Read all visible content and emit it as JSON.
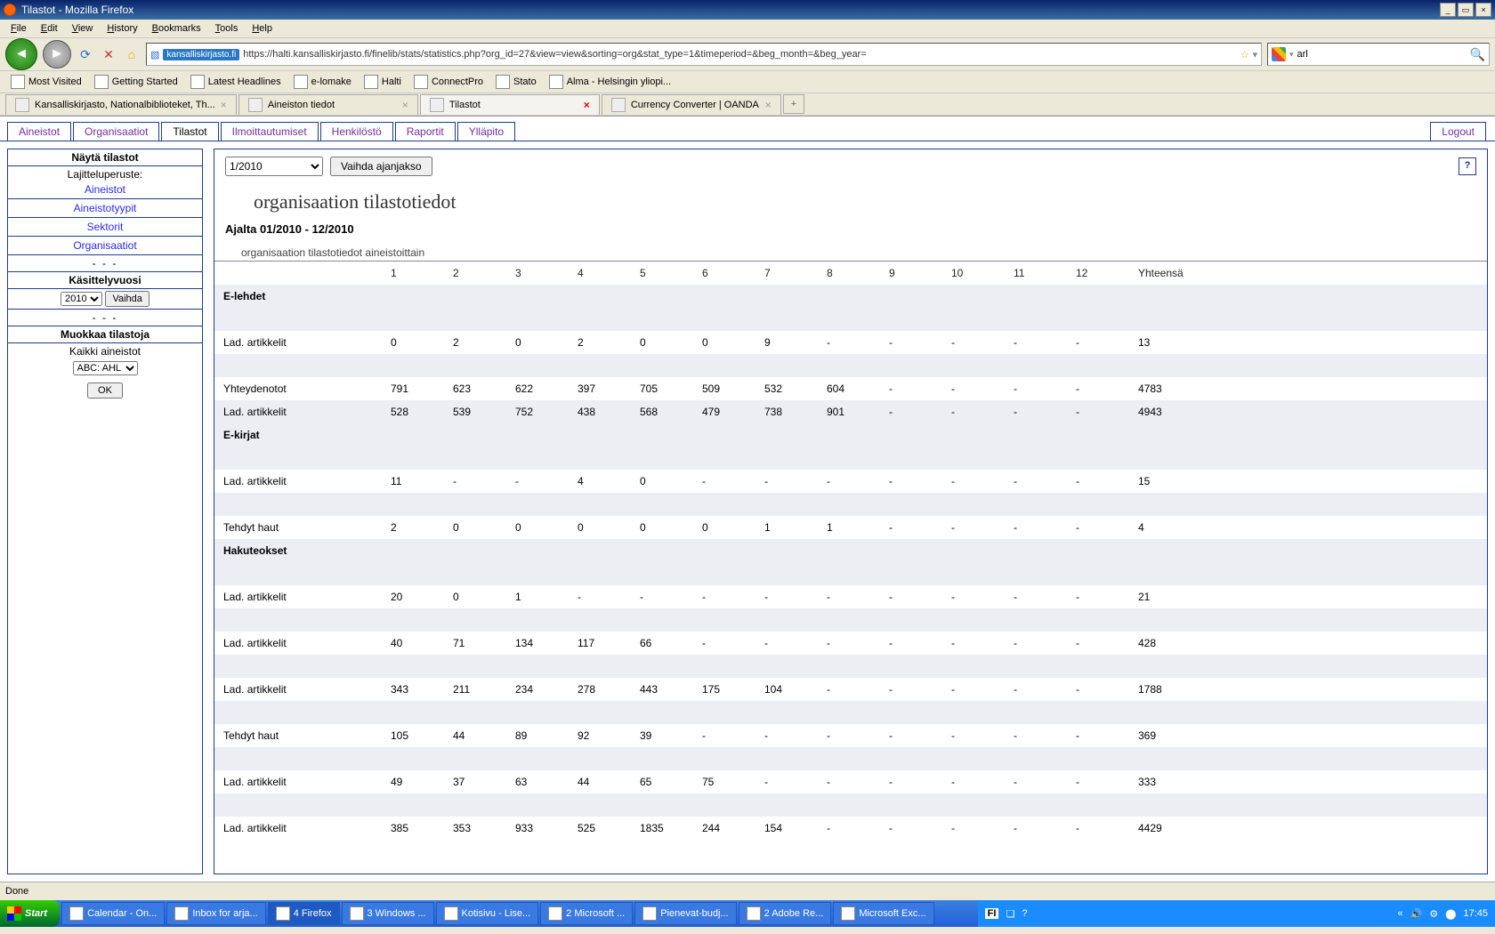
{
  "window_title": "Tilastot - Mozilla Firefox",
  "menubar": [
    "File",
    "Edit",
    "View",
    "History",
    "Bookmarks",
    "Tools",
    "Help"
  ],
  "url": "https://halti.kansalliskirjasto.fi/finelib/stats/statistics.php?org_id=27&view=view&sorting=org&stat_type=1&timeperiod=&beg_month=&beg_year=",
  "url_badge": "kansalliskirjasto.fi",
  "search_value": "arl",
  "bookmarks": [
    "Most Visited",
    "Getting Started",
    "Latest Headlines",
    "e-lomake",
    "Halti",
    "ConnectPro",
    "Stato",
    "Alma - Helsingin yliopi..."
  ],
  "tabs": [
    {
      "label": "Kansalliskirjasto, Nationalbiblioteket, Th..."
    },
    {
      "label": "Aineiston tiedot"
    },
    {
      "label": "Tilastot",
      "active": true,
      "red_x": true
    },
    {
      "label": "Currency Converter | OANDA"
    }
  ],
  "apptabs": [
    "Aineistot",
    "Organisaatiot",
    "Tilastot",
    "Ilmoittautumiset",
    "Henkilöstö",
    "Raportit",
    "Ylläpito"
  ],
  "apptab_active": "Tilastot",
  "logout": "Logout",
  "sidebar": {
    "show_hdr": "Näytä tilastot",
    "sort_label": "Lajitteluperuste:",
    "links": [
      "Aineistot",
      "Aineistotyypit",
      "Sektorit",
      "Organisaatiot"
    ],
    "year_hdr": "Käsittelyvuosi",
    "year": "2010",
    "year_btn": "Vaihda",
    "edit_hdr": "Muokkaa tilastoja",
    "edit_sub": "Kaikki aineistot",
    "edit_select": "ABC: AHL",
    "ok": "OK"
  },
  "main": {
    "period": "1/2010",
    "period_btn": "Vaihda ajanjakso",
    "title": "organisaation tilastotiedot",
    "range": "Ajalta 01/2010 - 12/2010",
    "caption": "organisaation tilastotiedot aineistoittain",
    "total_label": "Yhteensä"
  },
  "rows": [
    {
      "type": "section",
      "label": "E-lehdet"
    },
    {
      "type": "blank"
    },
    {
      "label": "Lad. artikkelit",
      "v": [
        "0",
        "2",
        "0",
        "2",
        "0",
        "0",
        "9",
        "-",
        "-",
        "-",
        "-",
        "-"
      ],
      "t": "13"
    },
    {
      "type": "blank"
    },
    {
      "label": "Yhteydenotot",
      "v": [
        "791",
        "623",
        "622",
        "397",
        "705",
        "509",
        "532",
        "604",
        "-",
        "-",
        "-",
        "-"
      ],
      "t": "4783"
    },
    {
      "label": "Lad. artikkelit",
      "v": [
        "528",
        "539",
        "752",
        "438",
        "568",
        "479",
        "738",
        "901",
        "-",
        "-",
        "-",
        "-"
      ],
      "t": "4943"
    },
    {
      "type": "section",
      "label": "E-kirjat"
    },
    {
      "type": "blank"
    },
    {
      "label": "Lad. artikkelit",
      "v": [
        "11",
        "-",
        "-",
        "4",
        "0",
        "-",
        "-",
        "-",
        "-",
        "-",
        "-",
        "-"
      ],
      "t": "15"
    },
    {
      "type": "blank"
    },
    {
      "label": "Tehdyt haut",
      "v": [
        "2",
        "0",
        "0",
        "0",
        "0",
        "0",
        "1",
        "1",
        "-",
        "-",
        "-",
        "-"
      ],
      "t": "4"
    },
    {
      "type": "section",
      "label": "Hakuteokset"
    },
    {
      "type": "blank"
    },
    {
      "label": "Lad. artikkelit",
      "v": [
        "20",
        "0",
        "1",
        "-",
        "-",
        "-",
        "-",
        "-",
        "-",
        "-",
        "-",
        "-"
      ],
      "t": "21"
    },
    {
      "type": "blank"
    },
    {
      "label": "Lad. artikkelit",
      "v": [
        "40",
        "71",
        "134",
        "117",
        "66",
        "-",
        "-",
        "-",
        "-",
        "-",
        "-",
        "-"
      ],
      "t": "428"
    },
    {
      "type": "blank"
    },
    {
      "label": "Lad. artikkelit",
      "v": [
        "343",
        "211",
        "234",
        "278",
        "443",
        "175",
        "104",
        "-",
        "-",
        "-",
        "-",
        "-"
      ],
      "t": "1788"
    },
    {
      "type": "blank"
    },
    {
      "label": "Tehdyt haut",
      "v": [
        "105",
        "44",
        "89",
        "92",
        "39",
        "-",
        "-",
        "-",
        "-",
        "-",
        "-",
        "-"
      ],
      "t": "369"
    },
    {
      "type": "blank"
    },
    {
      "label": "Lad. artikkelit",
      "v": [
        "49",
        "37",
        "63",
        "44",
        "65",
        "75",
        "-",
        "-",
        "-",
        "-",
        "-",
        "-"
      ],
      "t": "333"
    },
    {
      "type": "blank"
    },
    {
      "label": "Lad. artikkelit",
      "v": [
        "385",
        "353",
        "933",
        "525",
        "1835",
        "244",
        "154",
        "-",
        "-",
        "-",
        "-",
        "-"
      ],
      "t": "4429"
    }
  ],
  "status": "Done",
  "taskbar": {
    "start": "Start",
    "tasks": [
      "Calendar - On...",
      "Inbox for arja...",
      "4 Firefox",
      "3 Windows ...",
      "Kotisivu - Lise...",
      "2 Microsoft ...",
      "Pienevat-budj...",
      "2 Adobe Re...",
      "Microsoft Exc..."
    ],
    "active_task": 2,
    "lang": "FI",
    "clock": "17:45"
  }
}
